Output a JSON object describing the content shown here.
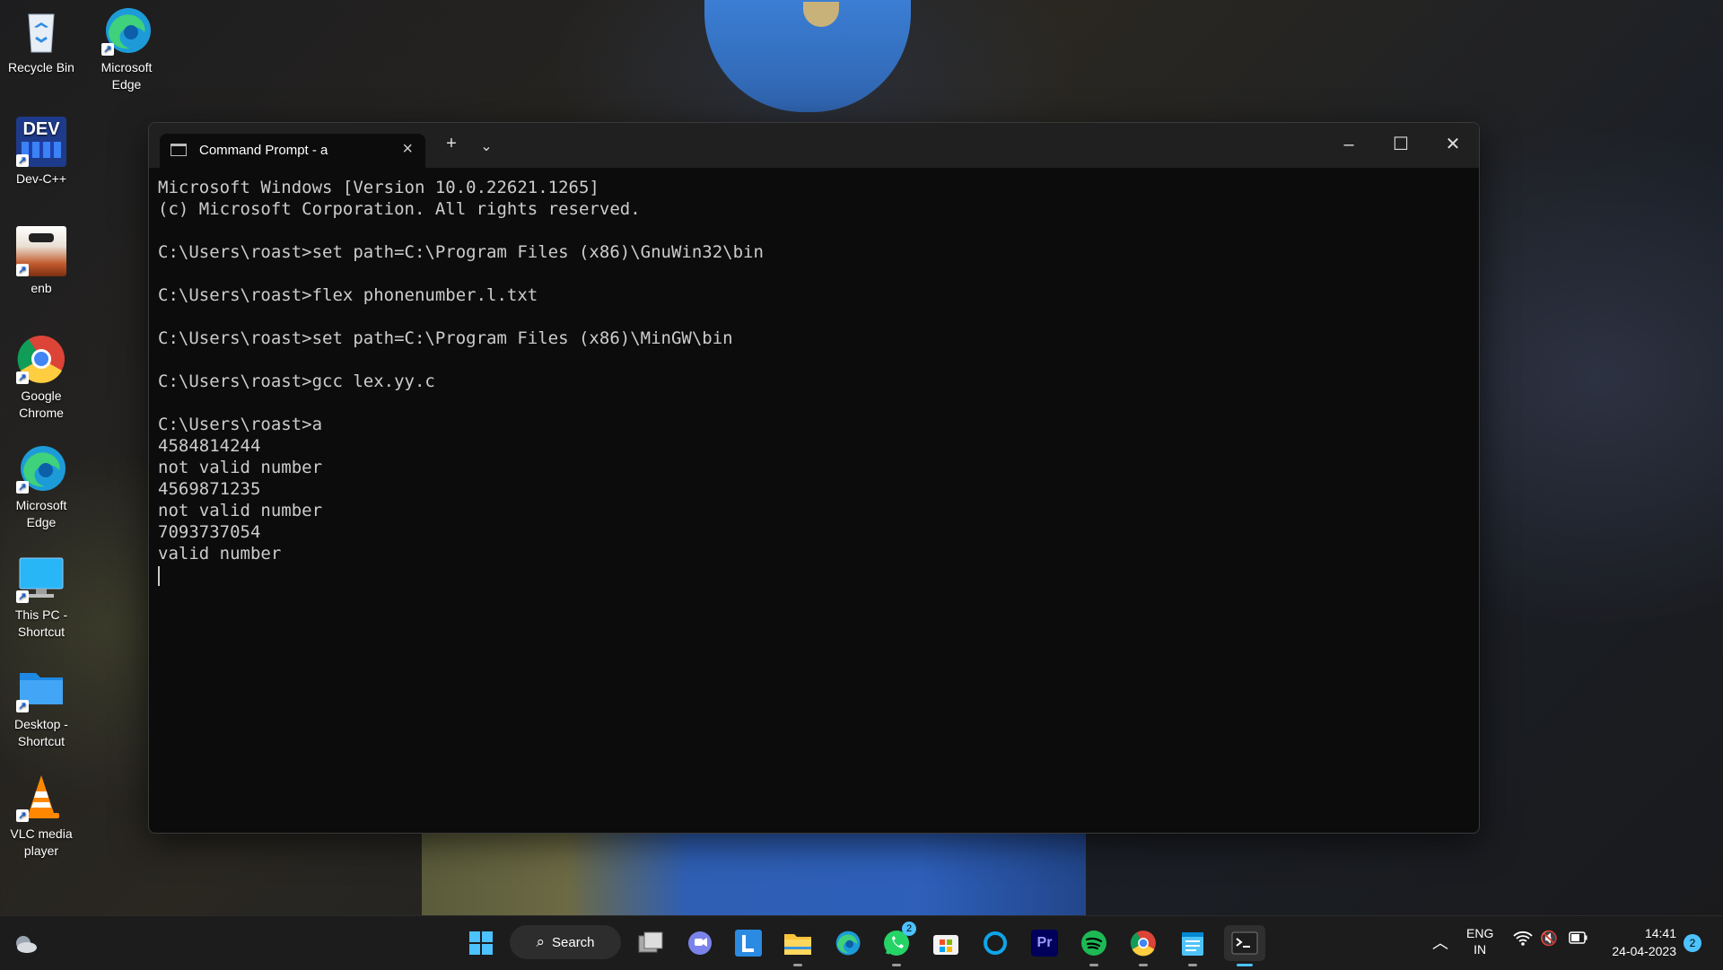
{
  "desktop": {
    "icons": [
      {
        "label": "Recycle Bin"
      },
      {
        "label": "Microsoft Edge"
      },
      {
        "label": "Dev-C++"
      },
      {
        "label": "enb"
      },
      {
        "label": "Google Chrome"
      },
      {
        "label": "Microsoft Edge"
      },
      {
        "label": "This PC - Shortcut"
      },
      {
        "label": "Desktop - Shortcut"
      },
      {
        "label": "VLC media player"
      }
    ],
    "devcpp_logo_text": "DEV"
  },
  "terminal": {
    "tab_title": "Command Prompt - a",
    "new_tab": "+",
    "lines": [
      "Microsoft Windows [Version 10.0.22621.1265]",
      "(c) Microsoft Corporation. All rights reserved.",
      "",
      "C:\\Users\\roast>set path=C:\\Program Files (x86)\\GnuWin32\\bin",
      "",
      "C:\\Users\\roast>flex phonenumber.l.txt",
      "",
      "C:\\Users\\roast>set path=C:\\Program Files (x86)\\MinGW\\bin",
      "",
      "C:\\Users\\roast>gcc lex.yy.c",
      "",
      "C:\\Users\\roast>a",
      "4584814244",
      "not valid number",
      "4569871235",
      "not valid number",
      "7093737054",
      "valid number"
    ]
  },
  "taskbar": {
    "search_label": "Search",
    "whatsapp_badge": "2",
    "premiere_label": "Pr",
    "language": "ENG",
    "region": "IN",
    "time": "14:41",
    "date": "24-04-2023",
    "notifications": "2"
  },
  "colors": {
    "taskbar_bg": "#1c1c1c",
    "terminal_bg": "#0c0c0c",
    "accent": "#3b8cf0"
  }
}
